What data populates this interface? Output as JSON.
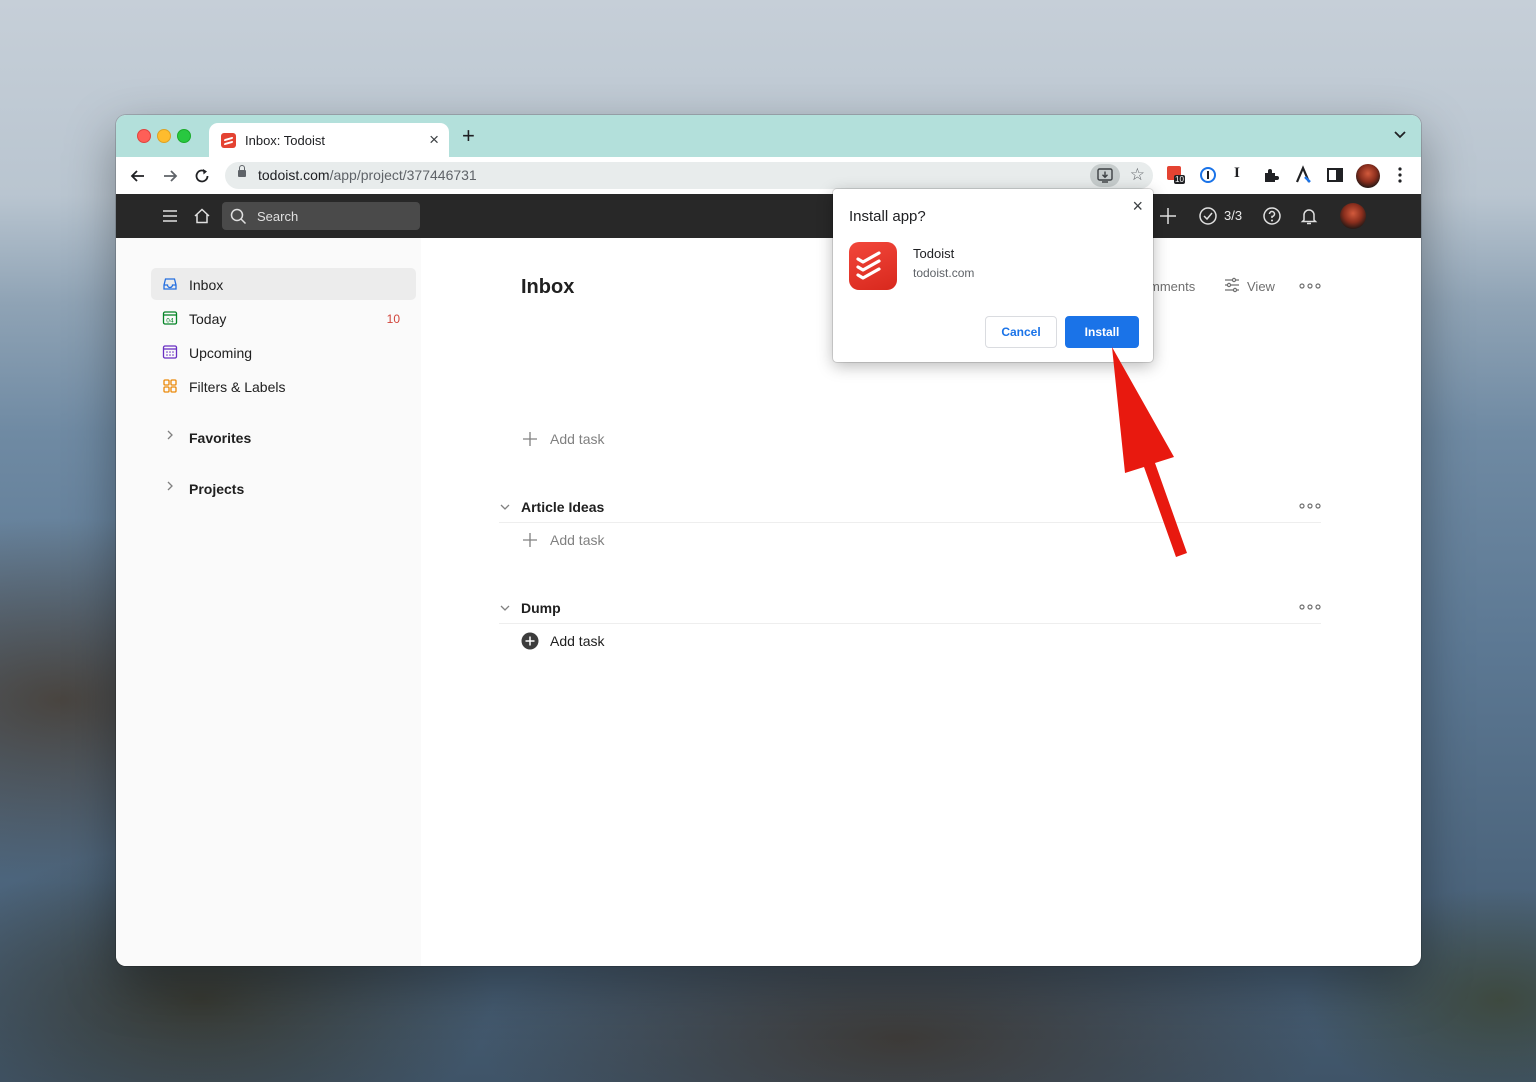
{
  "browser": {
    "tab_title": "Inbox: Todoist",
    "url_domain": "todoist.com",
    "url_path": "/app/project/377446731",
    "extension_badge": "10"
  },
  "header": {
    "search_placeholder": "Search",
    "karma": "3/3"
  },
  "sidebar": {
    "items": [
      {
        "label": "Inbox",
        "count": ""
      },
      {
        "label": "Today",
        "count": "10"
      },
      {
        "label": "Upcoming",
        "count": ""
      },
      {
        "label": "Filters & Labels",
        "count": ""
      }
    ],
    "groups": [
      {
        "label": "Favorites"
      },
      {
        "label": "Projects"
      }
    ]
  },
  "main": {
    "title": "Inbox",
    "comments_label": "mments",
    "view_label": "View",
    "add_task_label": "Add task",
    "sections": [
      {
        "title": "Article Ideas"
      },
      {
        "title": "Dump"
      }
    ]
  },
  "dialog": {
    "title": "Install app?",
    "app_name": "Todoist",
    "app_domain": "todoist.com",
    "cancel_label": "Cancel",
    "install_label": "Install"
  },
  "colors": {
    "tab_bar": "#b3e0db",
    "header": "#282828",
    "brand_red": "#e44332",
    "install_blue": "#1a73e8",
    "annotation_arrow": "#e8190f"
  }
}
